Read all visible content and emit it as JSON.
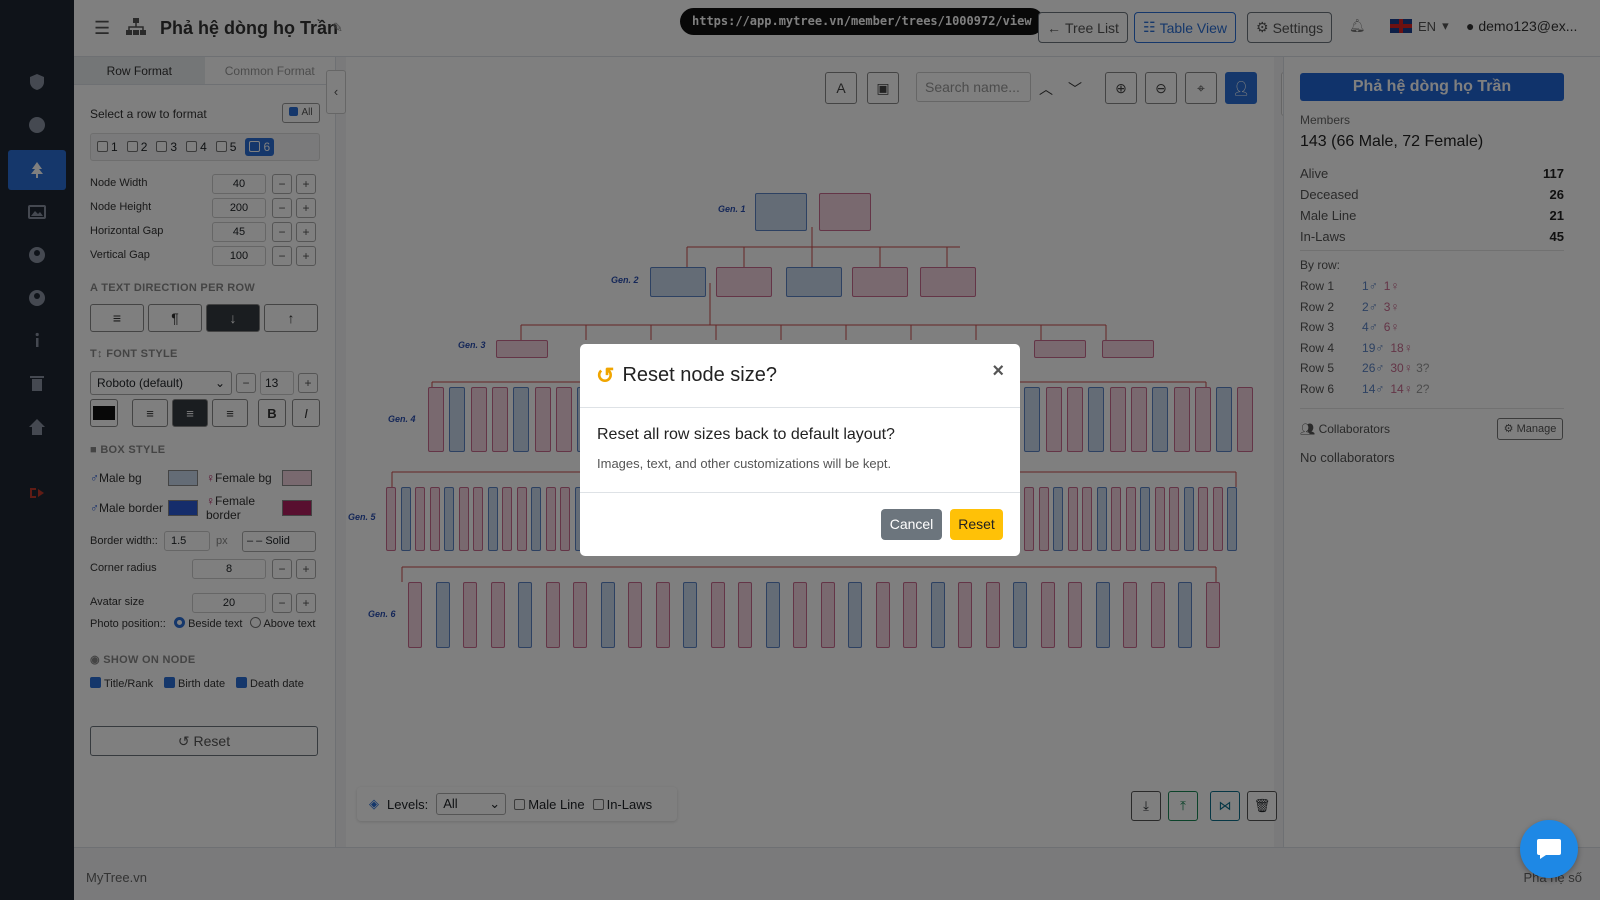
{
  "app": {
    "tree_title": "Phả hệ dòng họ Trần",
    "url": "https://app.mytree.vn/member/trees/1000972/view"
  },
  "topbar": {
    "tree_list": "Tree List",
    "table_view": "Table View",
    "settings": "Settings",
    "lang": "EN",
    "user": "demo123@ex..."
  },
  "left": {
    "tab_row": "Row Format",
    "tab_common": "Common Format",
    "select_row": "Select a row to format",
    "all_btn": "All",
    "rows": [
      "1",
      "2",
      "3",
      "4",
      "5",
      "6"
    ],
    "node_width_label": "Node Width",
    "node_width": "40",
    "node_height_label": "Node Height",
    "node_height": "200",
    "hgap_label": "Horizontal Gap",
    "hgap": "45",
    "vgap_label": "Vertical Gap",
    "vgap": "100",
    "text_dir": "TEXT DIRECTION PER ROW",
    "font_style": "FONT STYLE",
    "font": "Roboto (default)",
    "font_size": "13",
    "box_style": "BOX STYLE",
    "male_bg": "Male bg",
    "female_bg": "Female bg",
    "male_border": "Male border",
    "female_border": "Female border",
    "border_width_label": "Border width::",
    "border_width": "1.5",
    "px": "px",
    "border_style": "– – Solid",
    "corner_label": "Corner radius",
    "corner": "8",
    "avatar_label": "Avatar size",
    "avatar": "20",
    "photo_label": "Photo position::",
    "beside": "Beside text",
    "above": "Above text",
    "show_on_node": "SHOW ON NODE",
    "title_rank": "Title/Rank",
    "birth": "Birth date",
    "death": "Death date",
    "reset": "Reset"
  },
  "canvas": {
    "search_placeholder": "Search name...",
    "gens": [
      "Gen. 1",
      "Gen. 2",
      "Gen. 3",
      "Gen. 4",
      "Gen. 5",
      "Gen. 6"
    ],
    "levels_label": "Levels:",
    "levels_value": "All",
    "male_line": "Male Line",
    "in_laws": "In-Laws"
  },
  "right": {
    "title": "Phả hệ dòng họ Trần",
    "members_label": "Members",
    "members": "143 (66 Male, 72 Female)",
    "stats": [
      {
        "label": "Alive",
        "value": "117"
      },
      {
        "label": "Deceased",
        "value": "26"
      },
      {
        "label": "Male Line",
        "value": "21"
      },
      {
        "label": "In-Laws",
        "value": "45"
      }
    ],
    "by_row_label": "By row:",
    "by_row": [
      {
        "row": "Row 1",
        "m": "1♂",
        "f": "1♀",
        "u": ""
      },
      {
        "row": "Row 2",
        "m": "2♂",
        "f": "3♀",
        "u": ""
      },
      {
        "row": "Row 3",
        "m": "4♂",
        "f": "6♀",
        "u": ""
      },
      {
        "row": "Row 4",
        "m": "19♂",
        "f": "18♀",
        "u": ""
      },
      {
        "row": "Row 5",
        "m": "26♂",
        "f": "30♀",
        "u": "3?"
      },
      {
        "row": "Row 6",
        "m": "14♂",
        "f": "14♀",
        "u": "2?"
      }
    ],
    "collab_label": "Collaborators",
    "manage": "Manage",
    "no_collab": "No collaborators"
  },
  "footer": {
    "left": "MyTree.vn",
    "right": "Phả hệ số"
  },
  "modal": {
    "title": "Reset node size?",
    "question": "Reset all row sizes back to default layout?",
    "note": "Images, text, and other customizations will be kept.",
    "cancel": "Cancel",
    "reset": "Reset"
  },
  "colors": {
    "accent": "#2a6fd6",
    "male_bg": "#c9d8ec",
    "female_bg": "#f3d2de",
    "male_border": "#2a5bd6",
    "female_border": "#b01e5e",
    "reset_btn": "#ffc107"
  }
}
